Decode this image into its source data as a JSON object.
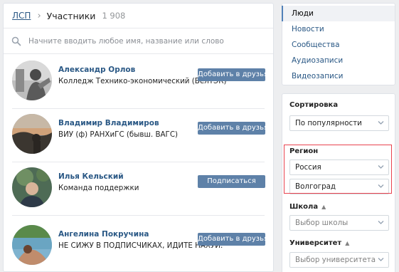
{
  "breadcrumb": {
    "parent": "ЛСП",
    "current": "Участники",
    "count": "1 908"
  },
  "search": {
    "placeholder": "Начните вводить любое имя, название или слово"
  },
  "people": [
    {
      "name": "Александр Орлов",
      "desc": "Колледж Технико-экономический (БелТЭК)",
      "button": "Добавить в друзья"
    },
    {
      "name": "Владимир Владимиров",
      "desc": "ВИУ (ф) РАНХиГС (бывш. ВАГС)",
      "button": "Добавить в друзья"
    },
    {
      "name": "Илья Кельский",
      "desc": "Команда поддержки",
      "button": "Подписаться"
    },
    {
      "name": "Ангелина Покручина",
      "desc": "НЕ СИЖУ В ПОДПИСЧИКАХ, ИДИТЕ НАХУЙ.",
      "button": "Добавить в друзья"
    }
  ],
  "nav": [
    "Люди",
    "Новости",
    "Сообщества",
    "Аудиозаписи",
    "Видеозаписи"
  ],
  "filters": {
    "sort_label": "Сортировка",
    "sort_value": "По популярности",
    "region_label": "Регион",
    "country_value": "Россия",
    "city_value": "Волгоград",
    "school_label": "Школа",
    "school_placeholder": "Выбор школы",
    "university_label": "Университет",
    "university_placeholder": "Выбор университета"
  },
  "colors": {
    "link": "#2a5885",
    "button": "#5e81a8",
    "highlight": "#e8434f"
  }
}
